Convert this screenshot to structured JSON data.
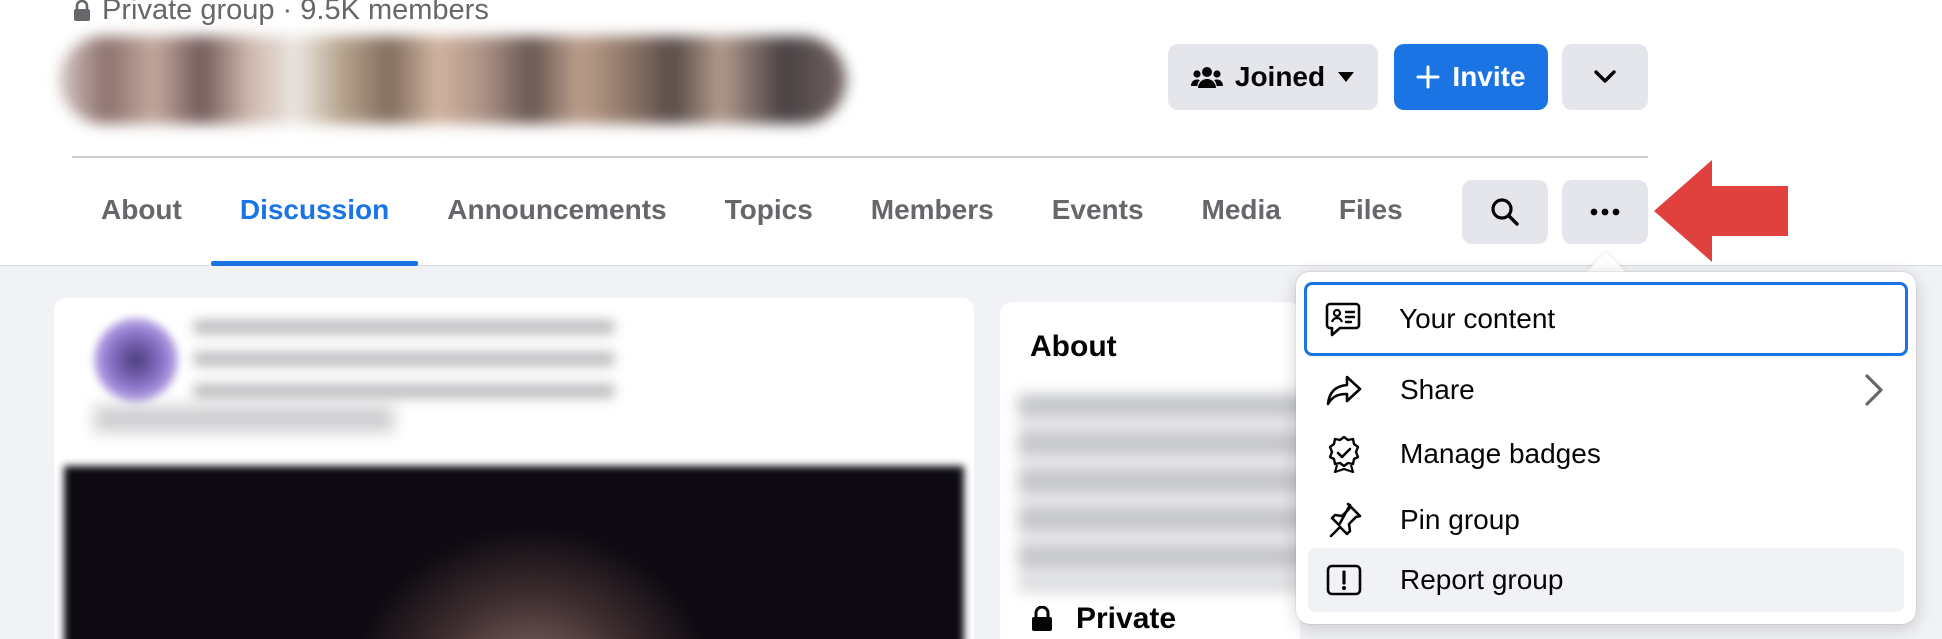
{
  "group": {
    "privacy_meta": "Private group · 9.5K members"
  },
  "header_actions": {
    "joined_label": "Joined",
    "invite_label": "Invite"
  },
  "tabs": [
    {
      "label": "About"
    },
    {
      "label": "Discussion",
      "active": true
    },
    {
      "label": "Announcements"
    },
    {
      "label": "Topics"
    },
    {
      "label": "Members"
    },
    {
      "label": "Events"
    },
    {
      "label": "Media"
    },
    {
      "label": "Files"
    }
  ],
  "about_card": {
    "title": "About",
    "privacy_label": "Private"
  },
  "dropdown_menu": {
    "items": [
      {
        "label": "Your content",
        "icon": "your-content-icon",
        "focused": true
      },
      {
        "label": "Share",
        "icon": "share-icon",
        "has_submenu": true
      },
      {
        "label": "Manage badges",
        "icon": "badge-icon"
      },
      {
        "label": "Pin group",
        "icon": "pin-icon"
      },
      {
        "label": "Report group",
        "icon": "report-icon",
        "hovered": true
      }
    ]
  },
  "colors": {
    "accent": "#1b74e4",
    "annotation_arrow": "#e0413e",
    "page_bg": "#f0f2f5",
    "button_gray": "#e4e6eb"
  }
}
